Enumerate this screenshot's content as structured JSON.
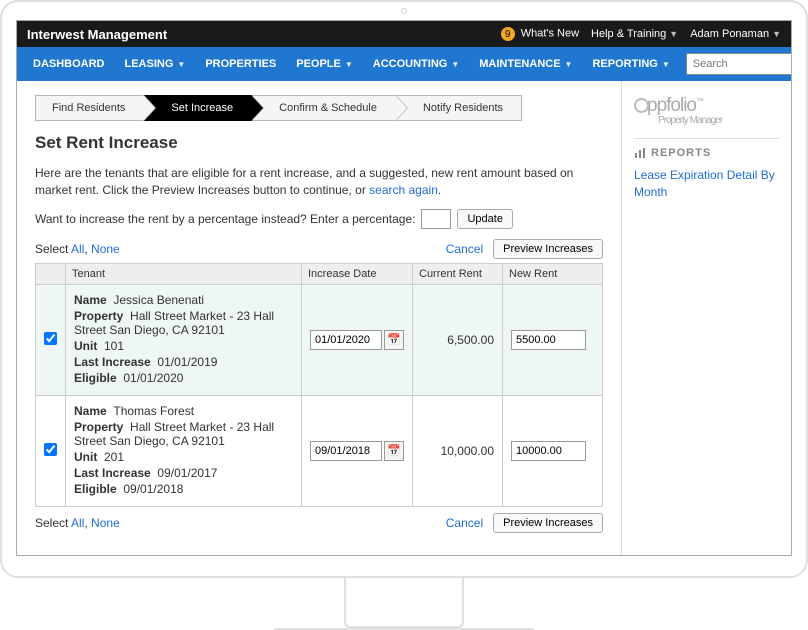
{
  "topbar": {
    "company": "Interwest Management",
    "badge": "9",
    "whatsnew": "What's New",
    "help": "Help & Training",
    "user": "Adam Ponaman"
  },
  "nav": {
    "dashboard": "DASHBOARD",
    "leasing": "LEASING",
    "properties": "PROPERTIES",
    "people": "PEOPLE",
    "accounting": "ACCOUNTING",
    "maintenance": "MAINTENANCE",
    "reporting": "REPORTING",
    "search_placeholder": "Search"
  },
  "crumbs": {
    "c1": "Find Residents",
    "c2": "Set Increase",
    "c3": "Confirm & Schedule",
    "c4": "Notify Residents"
  },
  "page": {
    "title": "Set Rent Increase",
    "desc1": "Here are the tenants that are eligible for a rent increase, and a suggested, new rent amount based on market rent. Click the Preview Increases button to continue, or ",
    "search_again": "search again",
    "percent_label": "Want to increase the rent by a percentage instead? Enter a percentage:",
    "update": "Update",
    "select_label": "Select ",
    "all": "All",
    "comma": ", ",
    "none": "None",
    "cancel": "Cancel",
    "preview": "Preview Increases"
  },
  "headers": {
    "checkbox": "",
    "tenant": "Tenant",
    "increase_date": "Increase Date",
    "current_rent": "Current Rent",
    "new_rent": "New Rent"
  },
  "tenants": [
    {
      "name_label": "Name",
      "name": "Jessica Benenati",
      "property_label": "Property",
      "property": "Hall Street Market - 23 Hall Street San Diego, CA 92101",
      "unit_label": "Unit",
      "unit": "101",
      "last_increase_label": "Last Increase",
      "last_increase": "01/01/2019",
      "eligible_label": "Eligible",
      "eligible": "01/01/2020",
      "increase_date": "01/01/2020",
      "current_rent": "6,500.00",
      "new_rent": "5500.00"
    },
    {
      "name_label": "Name",
      "name": "Thomas Forest",
      "property_label": "Property",
      "property": "Hall Street Market - 23 Hall Street San Diego, CA 92101",
      "unit_label": "Unit",
      "unit": "201",
      "last_increase_label": "Last Increase",
      "last_increase": "09/01/2017",
      "eligible_label": "Eligible",
      "eligible": "09/01/2018",
      "increase_date": "09/01/2018",
      "current_rent": "10,000.00",
      "new_rent": "10000.00"
    }
  ],
  "sidebar": {
    "logo_first": "ppfolio",
    "logo_sub": "Property Manager",
    "reports": "REPORTS",
    "link1": "Lease Expiration Detail By Month"
  }
}
